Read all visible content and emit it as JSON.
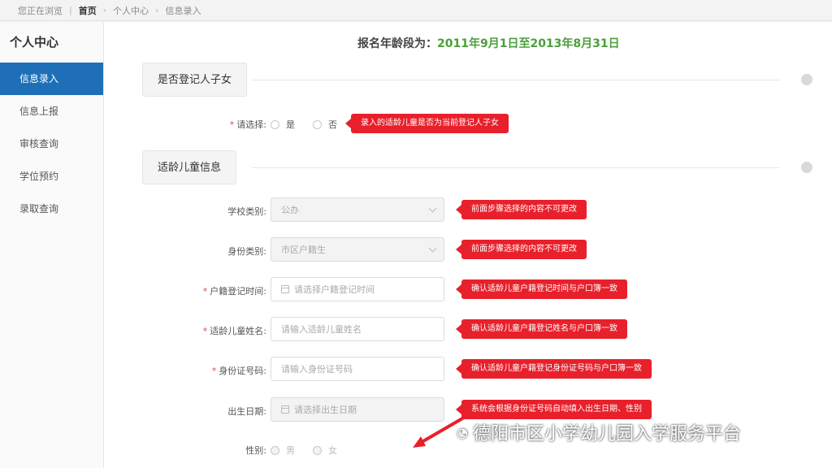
{
  "breadcrumb": {
    "prefix": "您正在浏览",
    "items": [
      "首页",
      "个人中心",
      "信息录入"
    ]
  },
  "sidebar": {
    "title": "个人中心",
    "items": [
      {
        "label": "信息录入"
      },
      {
        "label": "信息上报"
      },
      {
        "label": "审核查询"
      },
      {
        "label": "学位预约"
      },
      {
        "label": "录取查询"
      }
    ]
  },
  "main": {
    "age_range_label": "报名年龄段为：",
    "age_range_value": "2011年9月1日至2013年8月31日",
    "section1": {
      "title": "是否登记人子女",
      "select_label": "请选择:",
      "opt_yes": "是",
      "opt_no": "否",
      "callout": "录入的适龄儿童是否为当前登记人子女"
    },
    "section2": {
      "title": "适龄儿童信息",
      "school_type_label": "学校类别:",
      "school_type_value": "公办",
      "school_type_callout": "前面步骤选择的内容不可更改",
      "identity_label": "身份类别:",
      "identity_value": "市区户籍生",
      "identity_callout": "前面步骤选择的内容不可更改",
      "hukou_time_label": "户籍登记时间:",
      "hukou_time_placeholder": "请选择户籍登记时间",
      "hukou_time_callout": "确认适龄儿童户籍登记时间与户口簿一致",
      "name_label": "适龄儿童姓名:",
      "name_placeholder": "请输入适龄儿童姓名",
      "name_callout": "确认适龄儿童户籍登记姓名与户口簿一致",
      "id_label": "身份证号码:",
      "id_placeholder": "请输入身份证号码",
      "id_callout": "确认适龄儿童户籍登记身份证号码与户口簿一致",
      "birth_label": "出生日期:",
      "birth_placeholder": "请选择出生日期",
      "birth_callout": "系统会根据身份证号码自动填入出生日期、性别",
      "gender_label": "性别:",
      "gender_male": "男",
      "gender_female": "女"
    }
  },
  "watermark": "德阳市区小学幼儿园入学服务平台",
  "colors": {
    "accent": "#1e6fb8",
    "callout": "#e8202b",
    "highlight": "#4aa03a"
  }
}
